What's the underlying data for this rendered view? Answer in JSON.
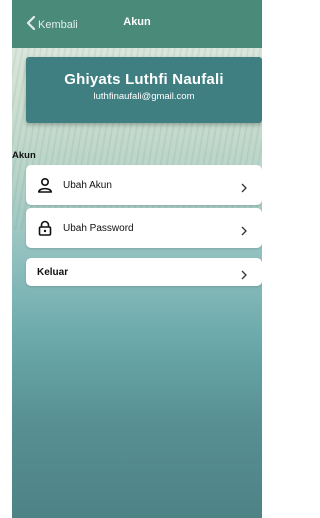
{
  "header": {
    "back_label": "Kembali",
    "title": "Akun"
  },
  "profile": {
    "name": "Ghiyats Luthfi Naufali",
    "email": "luthfinaufali@gmail.com"
  },
  "section": {
    "label": "Akun"
  },
  "menu": {
    "items": [
      {
        "label": "Ubah Akun",
        "icon": "user-icon"
      },
      {
        "label": "Ubah Password",
        "icon": "lock-icon"
      }
    ],
    "logout_label": "Keluar"
  },
  "colors": {
    "header_bg": "#4a8a78",
    "card_bg": "#3f7f82",
    "background_bottom": "#4e8386"
  }
}
